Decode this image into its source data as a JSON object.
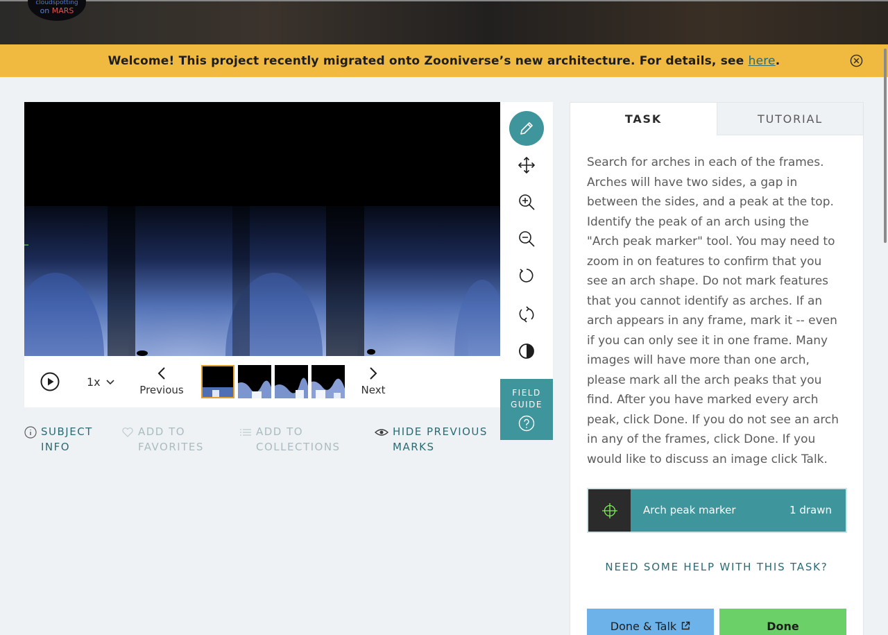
{
  "logo": {
    "line1": "cloudspotting",
    "line2a": "on ",
    "line2b": "MARS"
  },
  "banner": {
    "text": "Welcome! This project recently migrated onto Zooniverse’s new architecture. For details, see ",
    "link": "here",
    "end": "."
  },
  "viewer": {
    "speed": "1x",
    "previous": "Previous",
    "next": "Next",
    "frame_count": 4,
    "active_frame": 1
  },
  "toolbar": {
    "tools": [
      "pencil-icon",
      "move-icon",
      "zoom-in-icon",
      "zoom-out-icon",
      "rotate-icon",
      "reset-icon",
      "invert-icon"
    ],
    "field_guide_line1": "FIELD",
    "field_guide_line2": "GUIDE"
  },
  "meta": {
    "subject_info": [
      "SUBJECT",
      "INFO"
    ],
    "favorites": [
      "ADD TO",
      "FAVORITES"
    ],
    "collections": [
      "ADD TO",
      "COLLECTIONS"
    ],
    "hide_marks": [
      "HIDE PREVIOUS",
      "MARKS"
    ]
  },
  "task": {
    "tab_task": "TASK",
    "tab_tutorial": "TUTORIAL",
    "lines": [
      "Search for arches in each of the frames.",
      "Arches will have two sides, a gap in",
      "between the sides, and a peak at the top.",
      "Identify the peak of an arch using the",
      "\"Arch peak marker\" tool. You may need to",
      "zoom in on features to confirm that you",
      "see an arch shape. Do not mark features",
      "that you cannot identify as arches. If an",
      "arch appears in any frame, mark it -- even",
      "if you can only see it in one frame. Many",
      "images will have more than one arch,",
      "please mark all the arch peaks that you",
      "find. After you have marked every arch",
      "peak, click Done. If you do not see an arch",
      "in any of the frames, click Done. If you",
      "would like to discuss an image click Talk."
    ],
    "tool_label": "Arch peak marker",
    "tool_count": "1 drawn",
    "help": "NEED SOME HELP WITH THIS TASK?",
    "done_talk": "Done & Talk",
    "done": "Done"
  },
  "colors": {
    "accent": "#3f959c",
    "banner": "#f0b940",
    "done": "#6bd067",
    "talk": "#6db3ea",
    "marker": "#7ff05a"
  }
}
